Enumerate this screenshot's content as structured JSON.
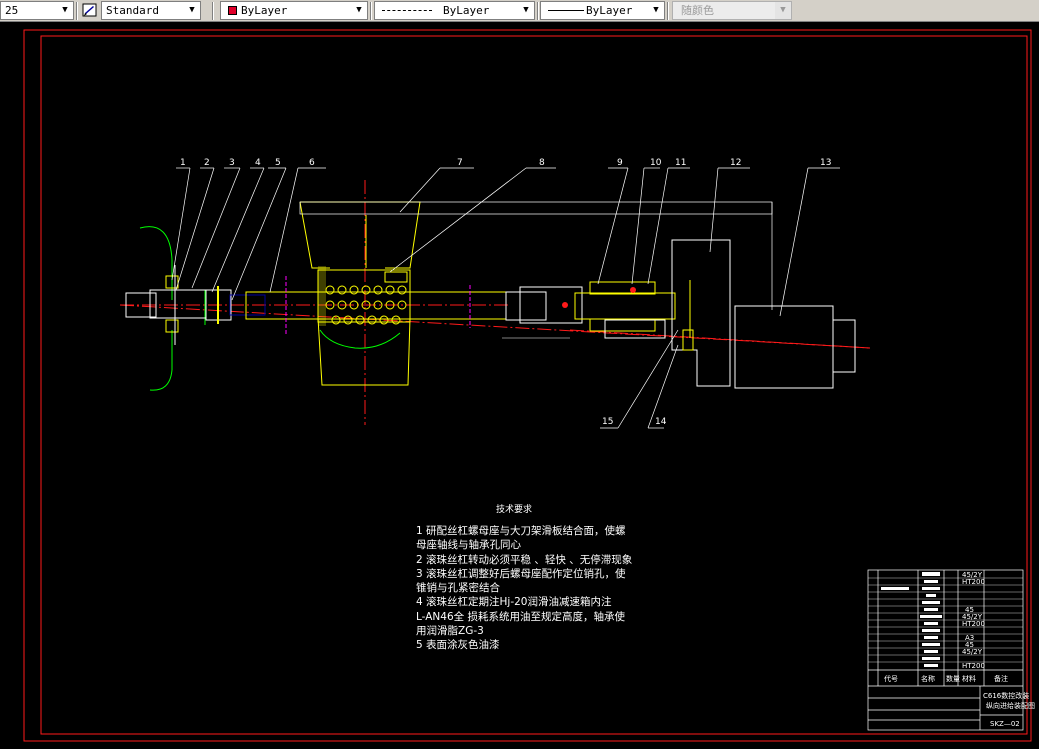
{
  "toolbar": {
    "scale_value": "25",
    "text_style": "Standard",
    "layer": "ByLayer",
    "linetype": "ByLayer",
    "lineweight": "ByLayer",
    "plot_style": "随颜色",
    "layer_color": "#e0002a"
  },
  "drawing": {
    "balloons": [
      "1",
      "2",
      "3",
      "4",
      "5",
      "6",
      "7",
      "8",
      "9",
      "10",
      "11",
      "12",
      "13",
      "15",
      "14"
    ],
    "notes_title": "技术要求",
    "notes": [
      "1  研配丝杠螺母座与大刀架滑板结合面，使螺",
      "母座轴线与轴承孔同心",
      "2  滚珠丝杠转动必须平稳 、轻快 、无停滞现象",
      "3  滚珠丝杠调整好后螺母座配作定位销孔，使",
      "锥销与孔紧密结合",
      "4  滚珠丝杠定期注Hj-20润滑油减速箱内注",
      "L-AN46全     损耗系统用油至规定高度，轴承使",
      "用润滑脂ZG-3",
      "5  表面涂灰色油漆"
    ],
    "title_block": {
      "drawing_title": "C616数控改装",
      "drawing_subtitle": "纵向进给装配图",
      "drawing_number": "SKZ—02",
      "header_cells": [
        "代号",
        "名称",
        "数量",
        "材料",
        "备注"
      ],
      "material_codes": [
        "45/2Y",
        "HT200",
        "45",
        "45/2Y",
        "HT200",
        "A3",
        "45",
        "45/2Y",
        "HT200"
      ]
    },
    "colors": {
      "border": "#ff1a1a",
      "part": "#ffff00",
      "outline": "#ffffff",
      "center": "#ff1a1a",
      "green": "#00ff00",
      "magenta": "#ff00ff"
    }
  }
}
